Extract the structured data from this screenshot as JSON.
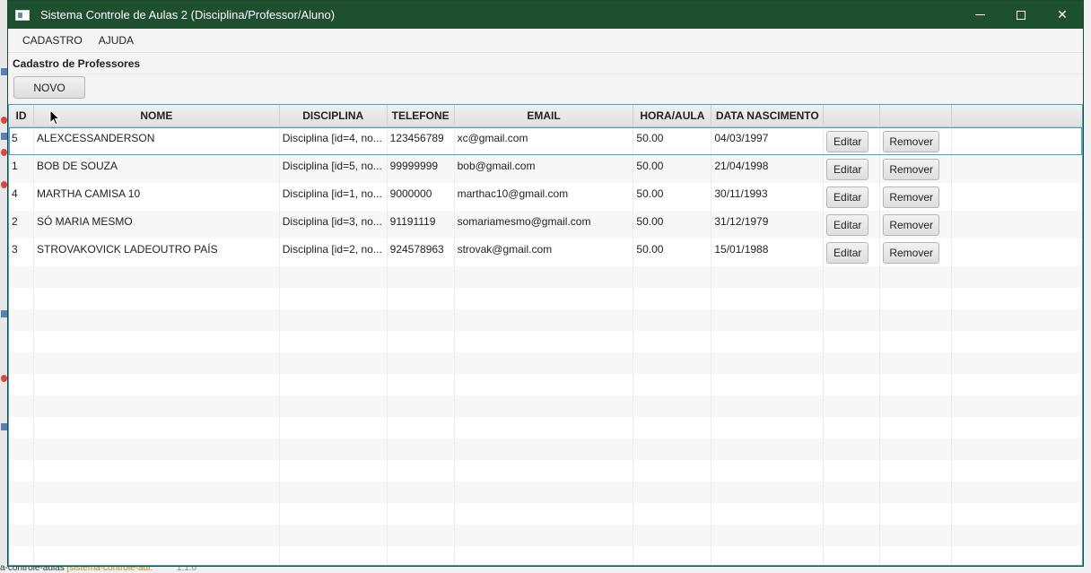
{
  "window": {
    "title": "Sistema Controle de Aulas 2 (Disciplina/Professor/Aluno)",
    "minimize_label": "",
    "maximize_label": "",
    "close_label": "✕"
  },
  "menu": {
    "items": [
      "CADASTRO",
      "AJUDA"
    ]
  },
  "section": {
    "title": "Cadastro de Professores"
  },
  "toolbar": {
    "novo_label": "NOVO"
  },
  "table": {
    "columns": [
      "ID",
      "NOME",
      "DISCIPLINA",
      "TELEFONE",
      "EMAIL",
      "HORA/AULA",
      "DATA NASCIMENTO",
      "",
      ""
    ],
    "edit_label": "Editar",
    "remove_label": "Remover",
    "rows": [
      {
        "id": "5",
        "nome": "ALEXCESSANDERSON",
        "disciplina": "Disciplina [id=4, no...",
        "telefone": "123456789",
        "email": "xc@gmail.com",
        "hora": "50.00",
        "nascimento": "04/03/1997"
      },
      {
        "id": "1",
        "nome": "BOB DE SOUZA",
        "disciplina": "Disciplina [id=5, no...",
        "telefone": "99999999",
        "email": "bob@gmail.com",
        "hora": "50.00",
        "nascimento": "21/04/1998"
      },
      {
        "id": "4",
        "nome": "MARTHA CAMISA 10",
        "disciplina": "Disciplina [id=1, no...",
        "telefone": "9000000",
        "email": "marthac10@gmail.com",
        "hora": "50.00",
        "nascimento": "30/11/1993"
      },
      {
        "id": "2",
        "nome": "SÓ MARIA MESMO",
        "disciplina": "Disciplina [id=3, no...",
        "telefone": "91191119",
        "email": "somariamesmo@gmail.com",
        "hora": "50.00",
        "nascimento": "31/12/1979"
      },
      {
        "id": "3",
        "nome": "STROVAKOVICK LADEOUTRO PAÍS",
        "disciplina": "Disciplina [id=2, no...",
        "telefone": "924578963",
        "email": "strovak@gmail.com",
        "hora": "50.00",
        "nascimento": "15/01/1988"
      }
    ],
    "selected_row": 0
  },
  "background": {
    "status_project": "a-controle-aulas",
    "status_branch": "[sistema-controle-aul:",
    "status_version": "1.1.0"
  },
  "colors": {
    "titlebar": "#1e5030",
    "selection": "#4ba2c9"
  }
}
